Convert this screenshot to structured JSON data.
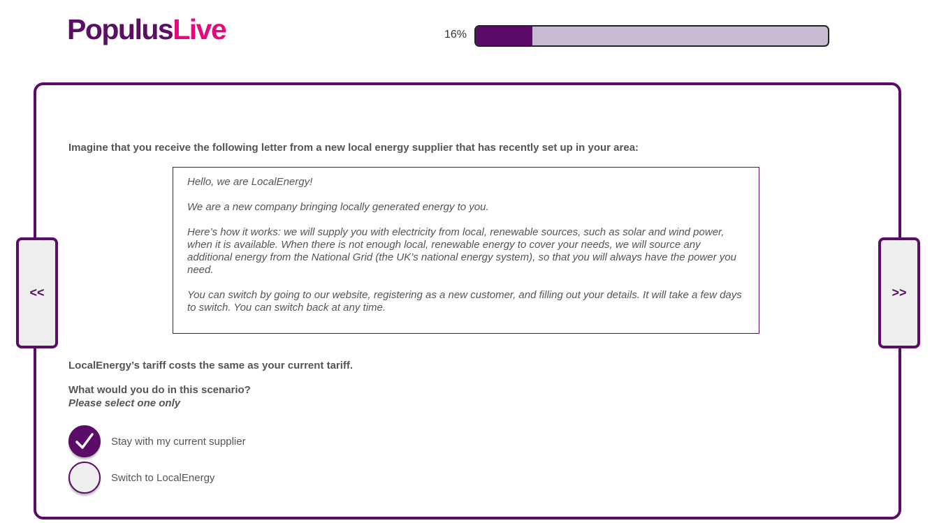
{
  "logo": {
    "part1": "Populus",
    "part2": "Live"
  },
  "progress": {
    "label": "16%",
    "value": 0.16
  },
  "nav": {
    "prev_label": "<<",
    "next_label": ">>"
  },
  "intro": "Imagine that you receive the following letter from a new local energy supplier that has recently set up in your area:",
  "letter": {
    "paragraphs": [
      "Hello, we are LocalEnergy!",
      "We are a new company bringing locally generated energy to you.",
      "Here’s how it works: we will supply you with electricity from local, renewable sources, such as solar and wind power, when it is available. When there is not enough local, renewable energy to cover your needs, we will source any additional energy from the National Grid (the UK’s national energy system), so that you will always have the power you need.",
      "You can switch by going to our website, registering as a new customer, and filling out your details. It will take a few days to switch. You can switch back at any time."
    ]
  },
  "tariff_text": "LocalEnergy’s tariff costs the same as your current tariff.",
  "question": "What would you do in this scenario?",
  "instruction": "Please select one only",
  "options": [
    {
      "label": "Stay with my current supplier",
      "selected": true
    },
    {
      "label": "Switch to LocalEnergy",
      "selected": false
    }
  ],
  "colors": {
    "brand_purple": "#5b0b68",
    "brand_pink": "#e5097f",
    "progress_track": "#c8bad0"
  }
}
